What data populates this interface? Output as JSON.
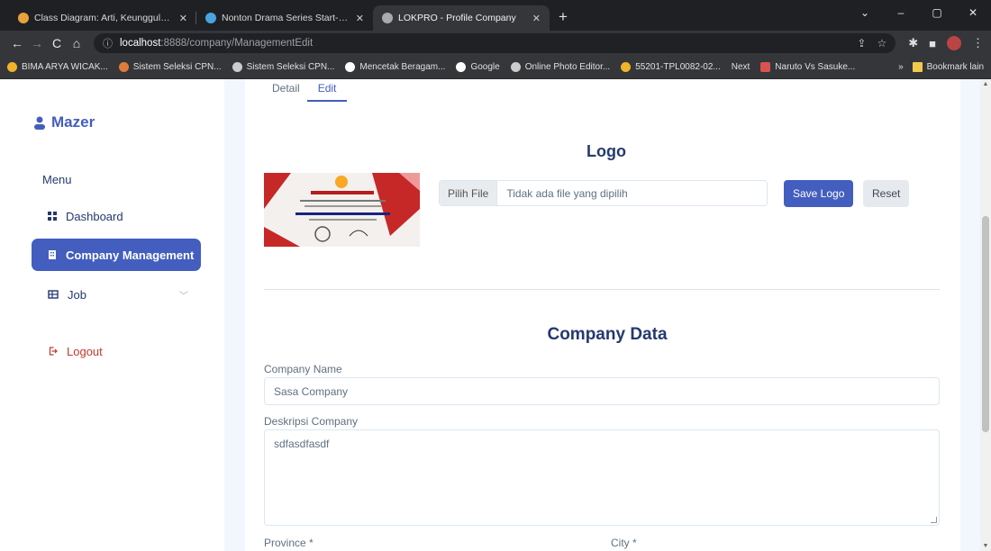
{
  "browser": {
    "tabs": [
      {
        "title": "Class Diagram: Arti, Keunggulan, Cara Membuat Beserta Contoh",
        "favicon_color": "#e9a23b",
        "active": false
      },
      {
        "title": "Nonton Drama Series Start-Up (Sub Indo)",
        "favicon_color": "#4aa3df",
        "active": false
      },
      {
        "title": "LOKPRO - Profile Company",
        "favicon_color": "#aaaaaa",
        "active": true
      }
    ],
    "new_tab": "+",
    "window_controls": [
      "⌄",
      "–",
      "▢",
      "✕"
    ],
    "url_host": "localhost",
    "url_path": ":8888/company/ManagementEdit",
    "bookmarks": [
      {
        "label": "BIMA ARYA WICAK...",
        "favicon_color": "#f0b429"
      },
      {
        "label": "Sistem Seleksi CPN...",
        "favicon_color": "#e07b39"
      },
      {
        "label": "Sistem Seleksi CPN...",
        "favicon_color": "#cccccc"
      },
      {
        "label": "Mencetak Beragam...",
        "favicon_color": "#ffffff"
      },
      {
        "label": "Google",
        "favicon_color": "#ffffff"
      },
      {
        "label": "Online Photo Editor...",
        "favicon_color": "#cccccc"
      },
      {
        "label": "55201-TPL0082-02...",
        "favicon_color": "#f0b429"
      },
      {
        "label": "Next",
        "favicon_color": ""
      },
      {
        "label": "Naruto Vs Sasuke...",
        "favicon_color": "#d9534f"
      }
    ],
    "bookmarks_more": "»",
    "other_bookmarks": "Bookmark lain"
  },
  "sidebar": {
    "brand": "Mazer",
    "menu_title": "Menu",
    "items": [
      {
        "label": "Dashboard",
        "icon": "grid-icon",
        "active": false
      },
      {
        "label": "Company Management",
        "icon": "building-icon",
        "active": true
      },
      {
        "label": "Job",
        "icon": "table-icon",
        "active": false,
        "has_submenu": true
      },
      {
        "label": "Logout",
        "icon": "logout-icon",
        "active": false
      }
    ]
  },
  "content": {
    "tabs": [
      {
        "label": "Detail",
        "active": false
      },
      {
        "label": "Edit",
        "active": true
      }
    ],
    "logo_heading": "Logo",
    "file_button": "Pilih File",
    "file_status": "Tidak ada file yang dipilih",
    "save_logo": "Save Logo",
    "reset": "Reset",
    "company_heading": "Company Data",
    "company_name_label": "Company Name",
    "company_name_value": "Sasa Company",
    "description_label": "Deskripsi Company",
    "description_value": "sdfasdfasdf",
    "province_label": "Province *",
    "city_label": "City *"
  },
  "colors": {
    "primary": "#435ebe",
    "heading": "#25396f",
    "page_bg": "#f2f7ff"
  }
}
